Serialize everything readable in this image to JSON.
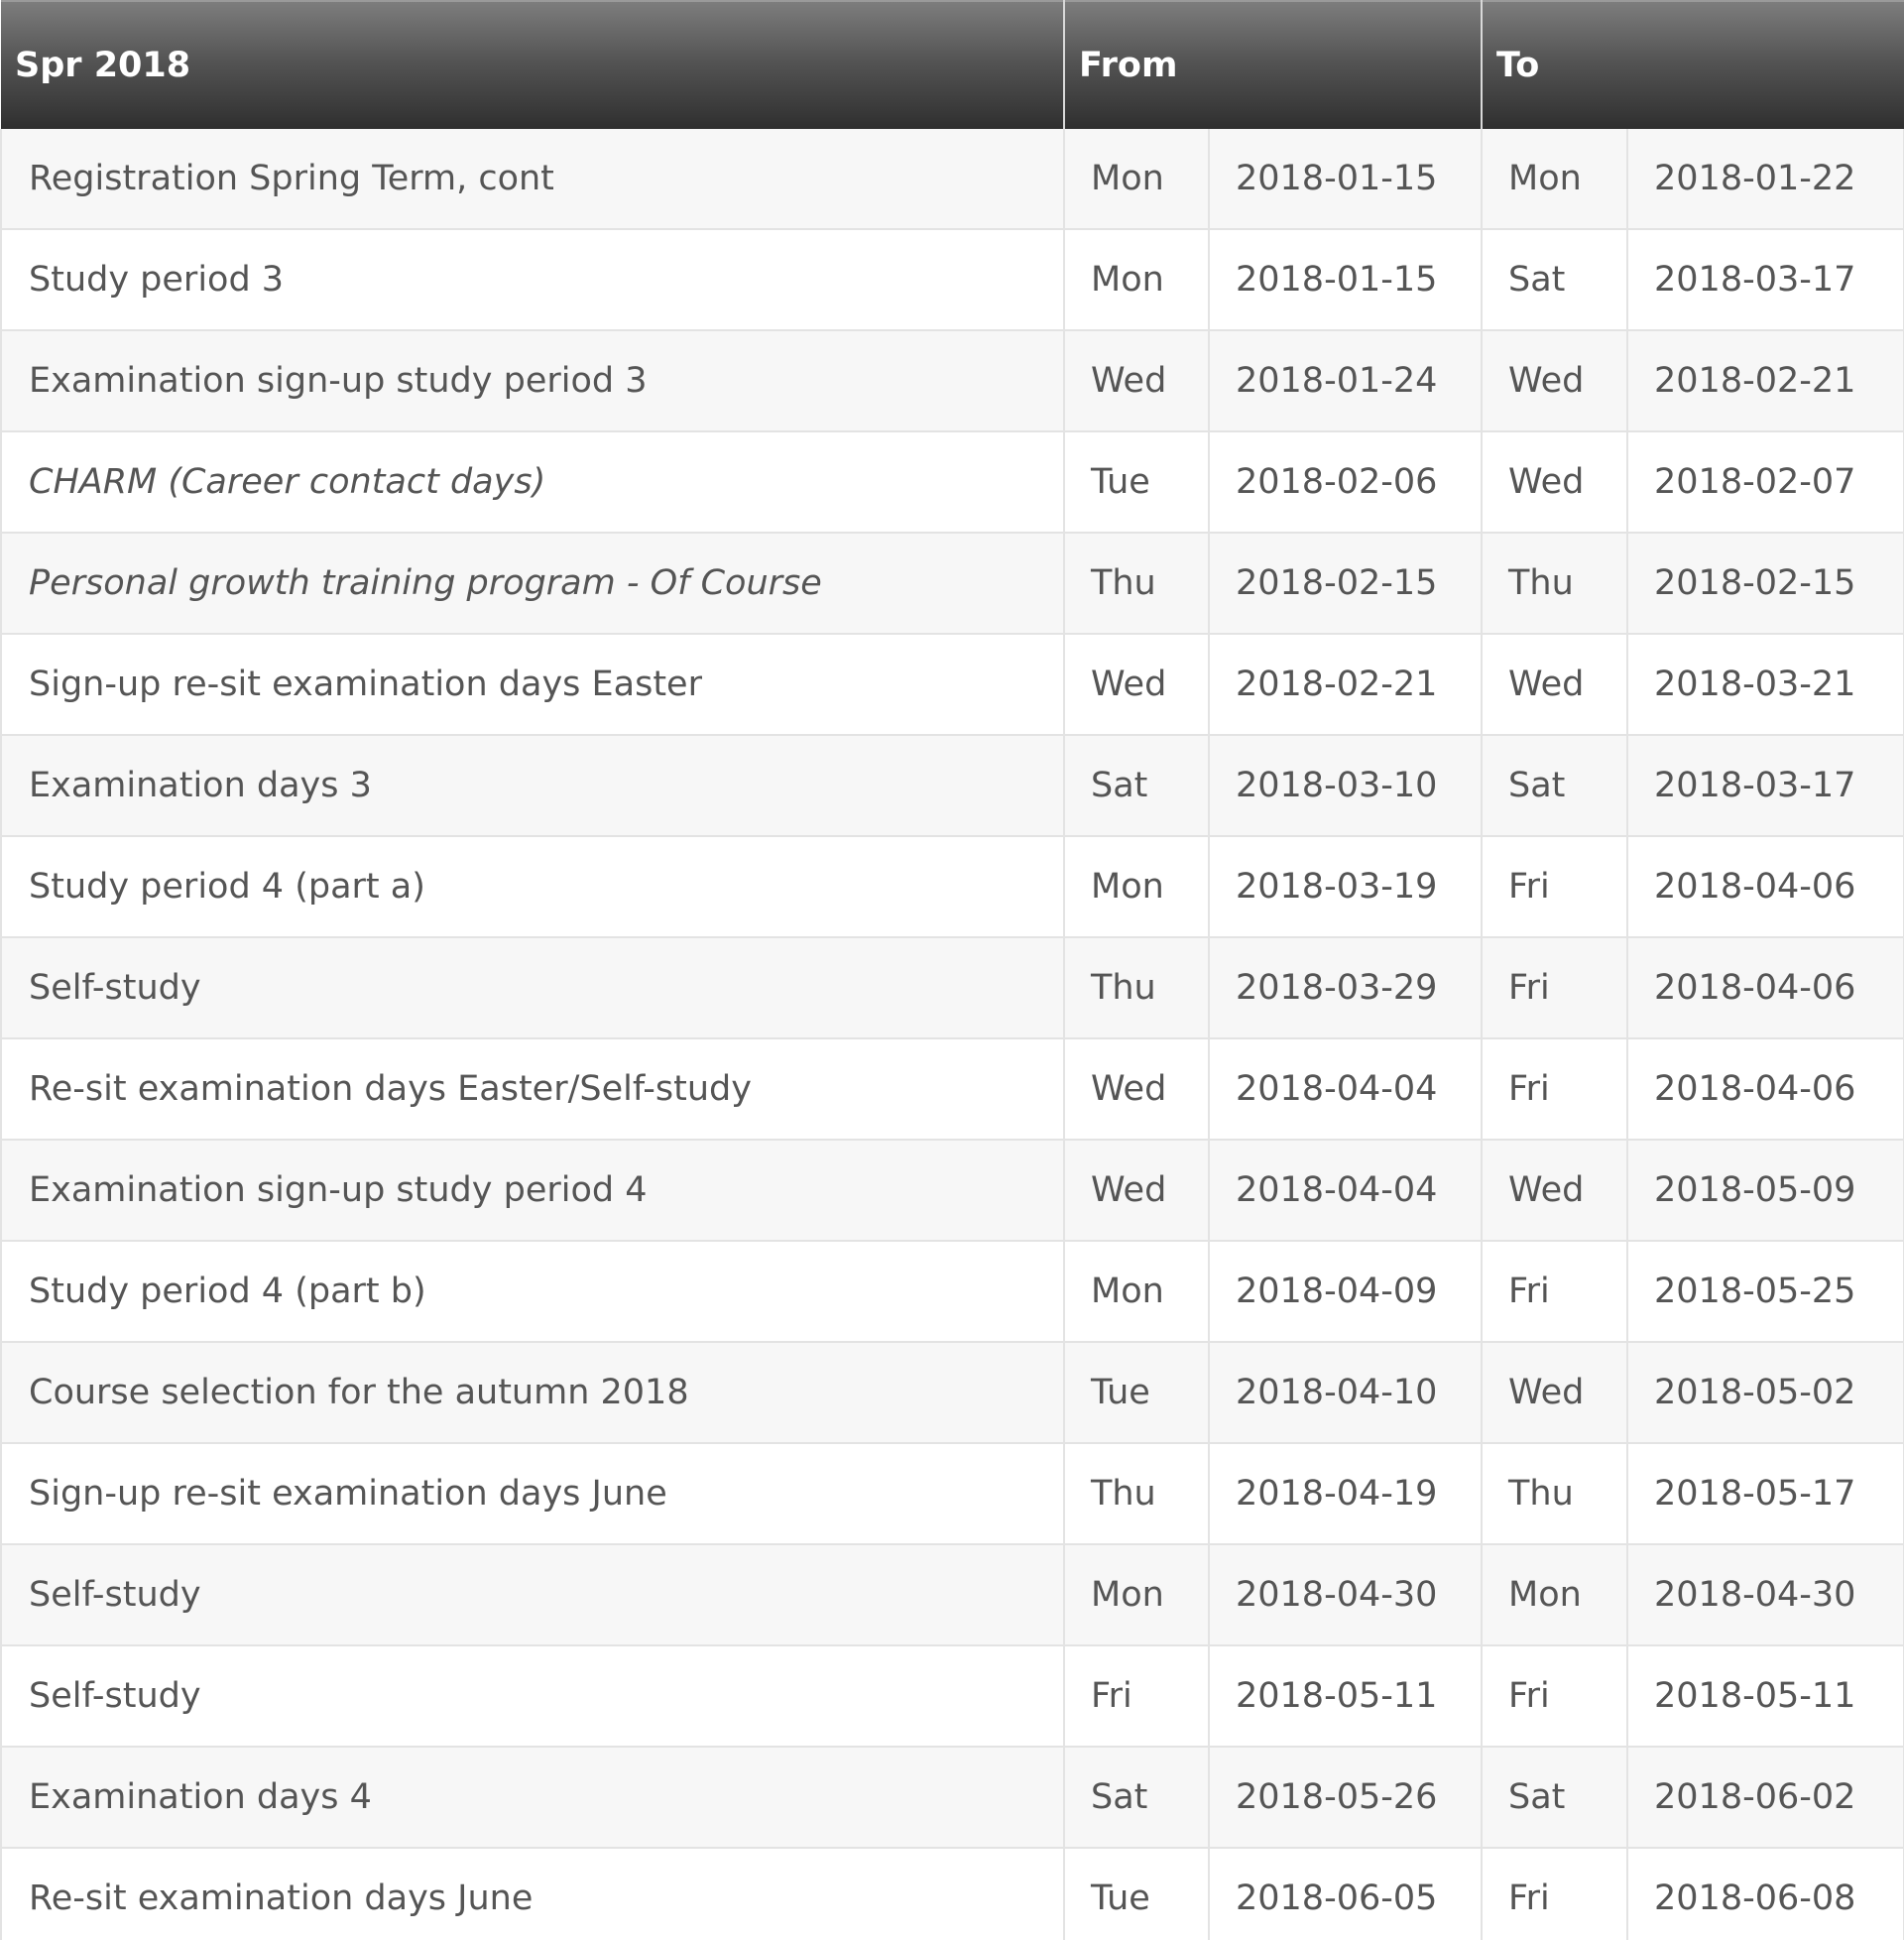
{
  "table": {
    "headers": {
      "event": "Spr 2018",
      "from": "From",
      "to": "To"
    },
    "rows": [
      {
        "event": "Registration Spring Term, cont",
        "italic": false,
        "from_day": "Mon",
        "from_date": "2018-01-15",
        "to_day": "Mon",
        "to_date": "2018-01-22"
      },
      {
        "event": "Study period 3",
        "italic": false,
        "from_day": "Mon",
        "from_date": "2018-01-15",
        "to_day": "Sat",
        "to_date": "2018-03-17"
      },
      {
        "event": "Examination sign-up study period 3",
        "italic": false,
        "from_day": "Wed",
        "from_date": "2018-01-24",
        "to_day": "Wed",
        "to_date": "2018-02-21"
      },
      {
        "event": "CHARM (Career contact days)",
        "italic": true,
        "from_day": "Tue",
        "from_date": "2018-02-06",
        "to_day": "Wed",
        "to_date": "2018-02-07"
      },
      {
        "event": "Personal growth training program - Of Course",
        "italic": true,
        "from_day": "Thu",
        "from_date": "2018-02-15",
        "to_day": "Thu",
        "to_date": "2018-02-15"
      },
      {
        "event": "Sign-up re-sit examination days Easter",
        "italic": false,
        "from_day": "Wed",
        "from_date": "2018-02-21",
        "to_day": "Wed",
        "to_date": "2018-03-21"
      },
      {
        "event": "Examination days 3",
        "italic": false,
        "from_day": "Sat",
        "from_date": "2018-03-10",
        "to_day": "Sat",
        "to_date": "2018-03-17"
      },
      {
        "event": "Study period 4 (part a)",
        "italic": false,
        "from_day": "Mon",
        "from_date": "2018-03-19",
        "to_day": "Fri",
        "to_date": "2018-04-06"
      },
      {
        "event": "Self-study",
        "italic": false,
        "from_day": "Thu",
        "from_date": "2018-03-29",
        "to_day": "Fri",
        "to_date": "2018-04-06"
      },
      {
        "event": "Re-sit examination days Easter/Self-study",
        "italic": false,
        "from_day": "Wed",
        "from_date": "2018-04-04",
        "to_day": "Fri",
        "to_date": "2018-04-06"
      },
      {
        "event": "Examination sign-up study period 4",
        "italic": false,
        "from_day": "Wed",
        "from_date": "2018-04-04",
        "to_day": "Wed",
        "to_date": "2018-05-09"
      },
      {
        "event": "Study period 4 (part b)",
        "italic": false,
        "from_day": "Mon",
        "from_date": "2018-04-09",
        "to_day": "Fri",
        "to_date": "2018-05-25"
      },
      {
        "event": "Course selection for the autumn 2018",
        "italic": false,
        "from_day": "Tue",
        "from_date": "2018-04-10",
        "to_day": "Wed",
        "to_date": "2018-05-02"
      },
      {
        "event": "Sign-up re-sit examination days June",
        "italic": false,
        "from_day": "Thu",
        "from_date": "2018-04-19",
        "to_day": "Thu",
        "to_date": "2018-05-17"
      },
      {
        "event": "Self-study",
        "italic": false,
        "from_day": "Mon",
        "from_date": "2018-04-30",
        "to_day": "Mon",
        "to_date": "2018-04-30"
      },
      {
        "event": "Self-study",
        "italic": false,
        "from_day": "Fri",
        "from_date": "2018-05-11",
        "to_day": "Fri",
        "to_date": "2018-05-11"
      },
      {
        "event": "Examination days 4",
        "italic": false,
        "from_day": "Sat",
        "from_date": "2018-05-26",
        "to_day": "Sat",
        "to_date": "2018-06-02"
      },
      {
        "event": "Re-sit examination days June",
        "italic": false,
        "from_day": "Tue",
        "from_date": "2018-06-05",
        "to_day": "Fri",
        "to_date": "2018-06-08"
      }
    ]
  }
}
